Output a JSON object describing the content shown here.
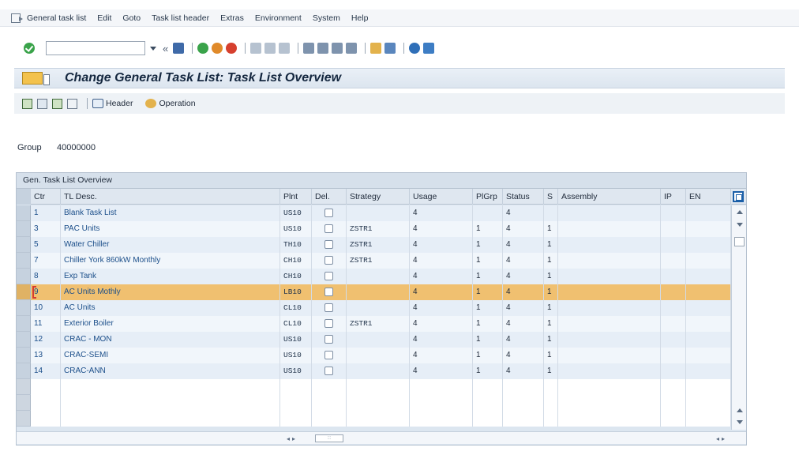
{
  "menubar": {
    "items": [
      "General task list",
      "Edit",
      "Goto",
      "Task list header",
      "Extras",
      "Environment",
      "System",
      "Help"
    ]
  },
  "title": "Change General Task List: Task List Overview",
  "app_toolbar": {
    "header_label": "Header",
    "operation_label": "Operation"
  },
  "group": {
    "label": "Group",
    "value": "40000000"
  },
  "table": {
    "title": "Gen. Task List Overview",
    "columns": [
      "Ctr",
      "TL Desc.",
      "Plnt",
      "Del.",
      "Strategy",
      "Usage",
      "PlGrp",
      "Status",
      "S",
      "Assembly",
      "IP",
      "EN"
    ],
    "rows": [
      {
        "ctr": "1",
        "desc": "Blank Task List",
        "plnt": "US10",
        "strategy": "",
        "usage": "4",
        "plgrp": "",
        "status": "4",
        "s": ""
      },
      {
        "ctr": "3",
        "desc": "PAC Units",
        "plnt": "US10",
        "strategy": "ZSTR1",
        "usage": "4",
        "plgrp": "1",
        "status": "4",
        "s": "1"
      },
      {
        "ctr": "5",
        "desc": "Water Chiller",
        "plnt": "TH10",
        "strategy": "ZSTR1",
        "usage": "4",
        "plgrp": "1",
        "status": "4",
        "s": "1"
      },
      {
        "ctr": "7",
        "desc": "Chiller York 860kW Monthly",
        "plnt": "CH10",
        "strategy": "ZSTR1",
        "usage": "4",
        "plgrp": "1",
        "status": "4",
        "s": "1"
      },
      {
        "ctr": "8",
        "desc": "Exp Tank",
        "plnt": "CH10",
        "strategy": "",
        "usage": "4",
        "plgrp": "1",
        "status": "4",
        "s": "1"
      },
      {
        "ctr": "9",
        "desc": "AC Units Mothly",
        "plnt": "LB10",
        "strategy": "",
        "usage": "4",
        "plgrp": "1",
        "status": "4",
        "s": "1"
      },
      {
        "ctr": "10",
        "desc": "AC Units",
        "plnt": "CL10",
        "strategy": "",
        "usage": "4",
        "plgrp": "1",
        "status": "4",
        "s": "1"
      },
      {
        "ctr": "11",
        "desc": "Exterior Boiler",
        "plnt": "CL10",
        "strategy": "ZSTR1",
        "usage": "4",
        "plgrp": "1",
        "status": "4",
        "s": "1"
      },
      {
        "ctr": "12",
        "desc": "CRAC - MON",
        "plnt": "US10",
        "strategy": "",
        "usage": "4",
        "plgrp": "1",
        "status": "4",
        "s": "1"
      },
      {
        "ctr": "13",
        "desc": "CRAC-SEMI",
        "plnt": "US10",
        "strategy": "",
        "usage": "4",
        "plgrp": "1",
        "status": "4",
        "s": "1"
      },
      {
        "ctr": "14",
        "desc": "CRAC-ANN",
        "plnt": "US10",
        "strategy": "",
        "usage": "4",
        "plgrp": "1",
        "status": "4",
        "s": "1"
      }
    ],
    "selected_row_index": 5,
    "empty_row_count": 3
  }
}
